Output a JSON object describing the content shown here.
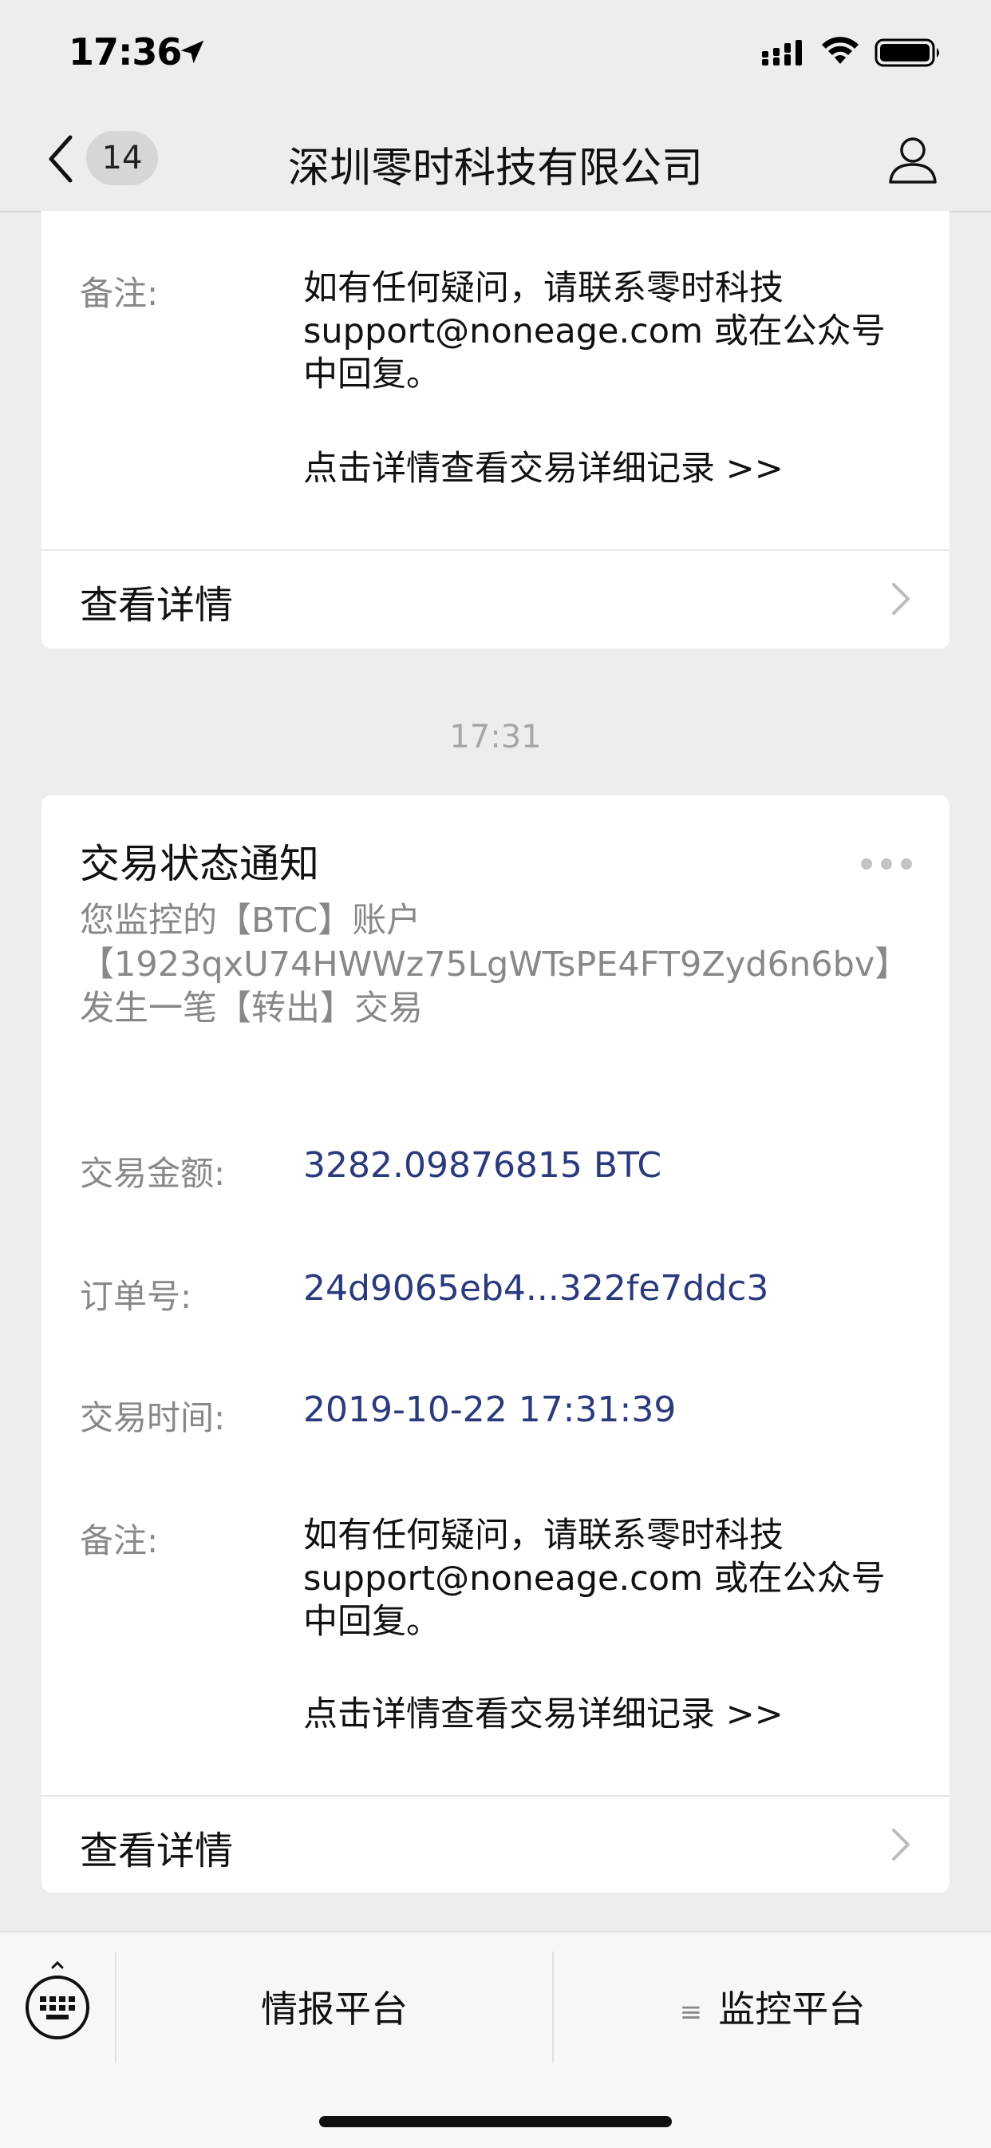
{
  "status_bar": {
    "time": "17:36"
  },
  "nav": {
    "unread_count": "14",
    "title": "深圳零时科技有限公司"
  },
  "card1": {
    "remark_label": "备注:",
    "remark_text": "如有任何疑问，请联系零时科技\nsupport@noneage.com 或在公众号\n中回复。",
    "remark_link": "点击详情查看交易详细记录 >>",
    "detail_label": "查看详情"
  },
  "timestamp": "17:31",
  "card2": {
    "title": "交易状态通知",
    "description": "您监控的【BTC】账户\n【1923qxU74HWWz75LgWTsPE4FT9Zyd6n6bv】\n发生一笔【转出】交易",
    "amount_label": "交易金额:",
    "amount_value": "3282.09876815 BTC",
    "order_label": "订单号:",
    "order_value": "24d9065eb4...322fe7ddc3",
    "time_label": "交易时间:",
    "time_value": "2019-10-22 17:31:39",
    "remark_label": "备注:",
    "remark_text": "如有任何疑问，请联系零时科技\nsupport@noneage.com 或在公众号\n中回复。",
    "remark_link": "点击详情查看交易详细记录 >>",
    "detail_label": "查看详情"
  },
  "bottom_menu": {
    "item1": "情报平台",
    "item2": "监控平台",
    "item2_icon": "≡"
  },
  "colors": {
    "background": "#EDEDED",
    "value_blue": "#2A3A7C",
    "muted": "#888888"
  }
}
